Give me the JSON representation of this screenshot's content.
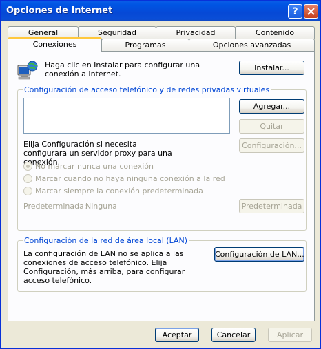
{
  "window": {
    "title": "Opciones de Internet"
  },
  "tabs": {
    "row1": [
      "General",
      "Seguridad",
      "Privacidad",
      "Contenido"
    ],
    "row2": [
      "Conexiones",
      "Programas",
      "Opciones avanzadas"
    ],
    "active": "Conexiones"
  },
  "setup": {
    "text": "Haga clic en Instalar para configurar una conexión a Internet.",
    "install_button": "Instalar..."
  },
  "dialup": {
    "group_title": "Configuración de acceso telefónico y de redes privadas virtuales",
    "add_button": "Agregar...",
    "remove_button": "Quitar",
    "settings_button": "Configuración...",
    "proxy_text": "Elija Configuración si necesita configurara un servidor proxy para una conexión.",
    "options": [
      {
        "label": "No marcar nunca una conexión",
        "selected": true
      },
      {
        "label": "Marcar cuando no haya ninguna conexión a la red",
        "selected": false
      },
      {
        "label": "Marcar siempre la conexión predeterminada",
        "selected": false
      }
    ],
    "default_label": "Predeterminada:",
    "default_value": "Ninguna",
    "default_button": "Predeterminada"
  },
  "lan": {
    "group_title": "Configuración de la red de área local (LAN)",
    "text": "La configuración de LAN no se aplica a las conexiones de acceso telefónico. Elija Configuración, más arriba, para configurar acceso telefónico.",
    "button": "Configuración de LAN..."
  },
  "footer": {
    "ok": "Aceptar",
    "cancel": "Cancelar",
    "apply": "Aplicar"
  },
  "colors": {
    "titlebar": "#0054E3",
    "dialog_bg": "#ECE9D8",
    "group_label": "#0046D5",
    "active_tab_accent": "#FFC83C"
  }
}
